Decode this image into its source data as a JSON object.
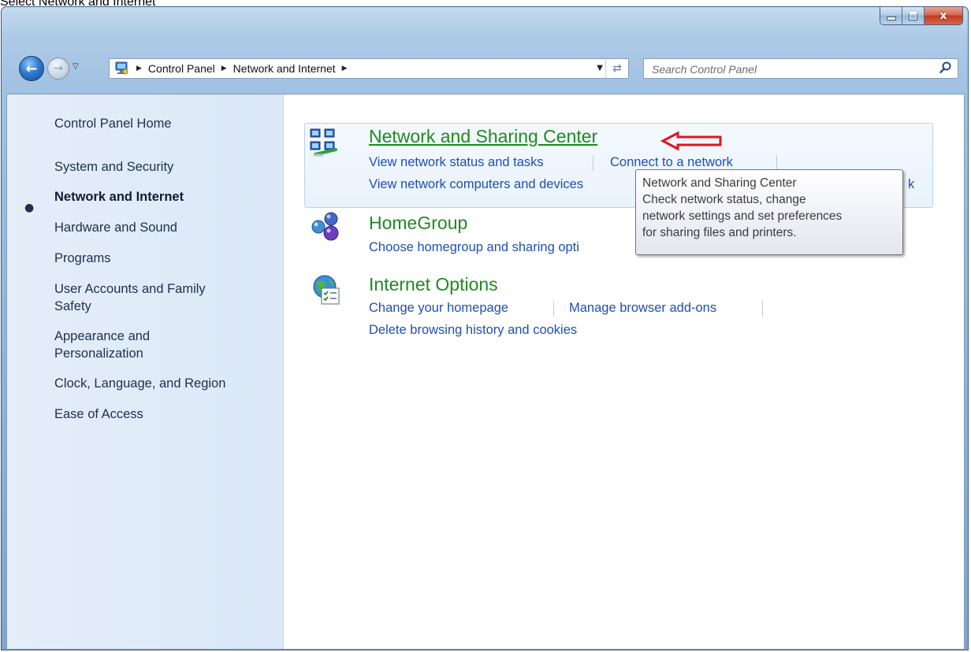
{
  "caption": "Select Network and Internet",
  "window": {
    "close_glyph": "x"
  },
  "address_bar": {
    "crumbs": [
      "Control Panel",
      "Network and Internet"
    ]
  },
  "search": {
    "placeholder": "Search Control Panel"
  },
  "sidebar": {
    "items": [
      "Control Panel Home",
      "System and Security",
      "Network and Internet",
      "Hardware and Sound",
      "Programs",
      "User Accounts and Family Safety",
      "Appearance and Personalization",
      "Clock, Language, and Region",
      "Ease of Access"
    ],
    "active_index": 2,
    "items_wrapped": {
      "user_accounts_line1": "User Accounts and Family",
      "user_accounts_line2": "Safety",
      "appearance_line1": "Appearance and",
      "appearance_line2": "Personalization"
    }
  },
  "categories": {
    "network_sharing": {
      "title": "Network and Sharing Center",
      "links": [
        "View network status and tasks",
        "Connect to a network",
        "View network computers and devices"
      ],
      "hidden_link_tail": "k",
      "icon": "network-sharing-icon"
    },
    "homegroup": {
      "title": "HomeGroup",
      "links": [
        "Choose homegroup and sharing opti"
      ],
      "icon": "homegroup-icon"
    },
    "internet_options": {
      "title": "Internet Options",
      "links": [
        "Change your homepage",
        "Manage browser add-ons",
        "Delete browsing history and cookies"
      ],
      "icon": "internet-options-icon"
    }
  },
  "tooltip": {
    "lines": [
      "Network and Sharing Center",
      "Check network status, change",
      "network settings and set preferences",
      "for sharing files and printers."
    ]
  },
  "colors": {
    "category_title": "#1e8a1e",
    "link": "#1e4fb3",
    "annotation_arrow": "#e0161e"
  }
}
